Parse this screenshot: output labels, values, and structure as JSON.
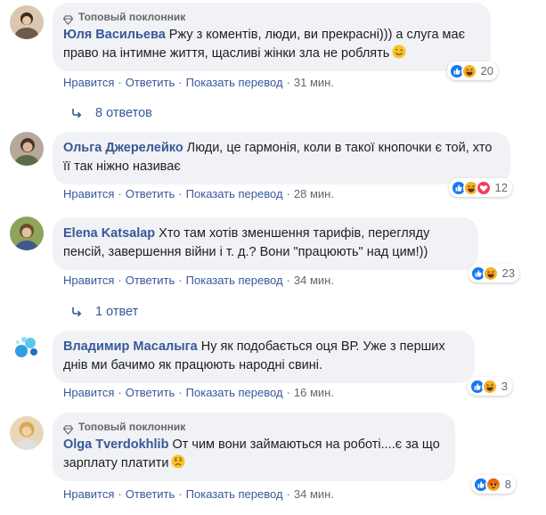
{
  "labels": {
    "like": "Нравится",
    "reply": "Ответить",
    "translate": "Показать перевод",
    "dot": "·",
    "top_fan": "Топовый поклонник"
  },
  "comments": [
    {
      "author": "Юля Васильева",
      "text": "Ржу з коментів, люди, ви прекрасні))) а слуга має право на інтимне життя, щасливі жінки зла не роблять",
      "time": "31 мин.",
      "reaction_count": "20",
      "top_fan": true
    },
    {
      "author": "Ольга Джерелейко",
      "text": "Люди, це гармонія, коли в такої кнопочки є той, хто її так ніжно називає",
      "time": "28 мин.",
      "reaction_count": "12",
      "top_fan": false
    },
    {
      "author": "Elena Katsalap",
      "text": "Хто там хотів зменшення тарифів, перегляду пенсій, завершення війни і т. д.? Вони \"працюють\" над цим!))",
      "time": "34 мин.",
      "reaction_count": "23",
      "top_fan": false
    },
    {
      "author": "Владимир Масалыга",
      "text": "Ну як подобається оця ВР. Уже з перших днів ми бачимо як працюють народні свині.",
      "time": "16 мин.",
      "reaction_count": "3",
      "top_fan": false
    },
    {
      "author": "Olga Tverdokhlib",
      "text": "От чим вони займаються на роботі....є за що зарплату платити",
      "time": "34 мин.",
      "reaction_count": "8",
      "top_fan": true
    }
  ],
  "replies": [
    {
      "label": "8 ответов"
    },
    {
      "label": "1 ответ"
    }
  ],
  "colors": {
    "link": "#385898",
    "meta": "#65676b",
    "bubble": "#f0f2f5",
    "like_blue": "#1877f2",
    "haha_yellow": "#f7b125",
    "love_red": "#f33e58",
    "angry_orange": "#e9710f"
  }
}
